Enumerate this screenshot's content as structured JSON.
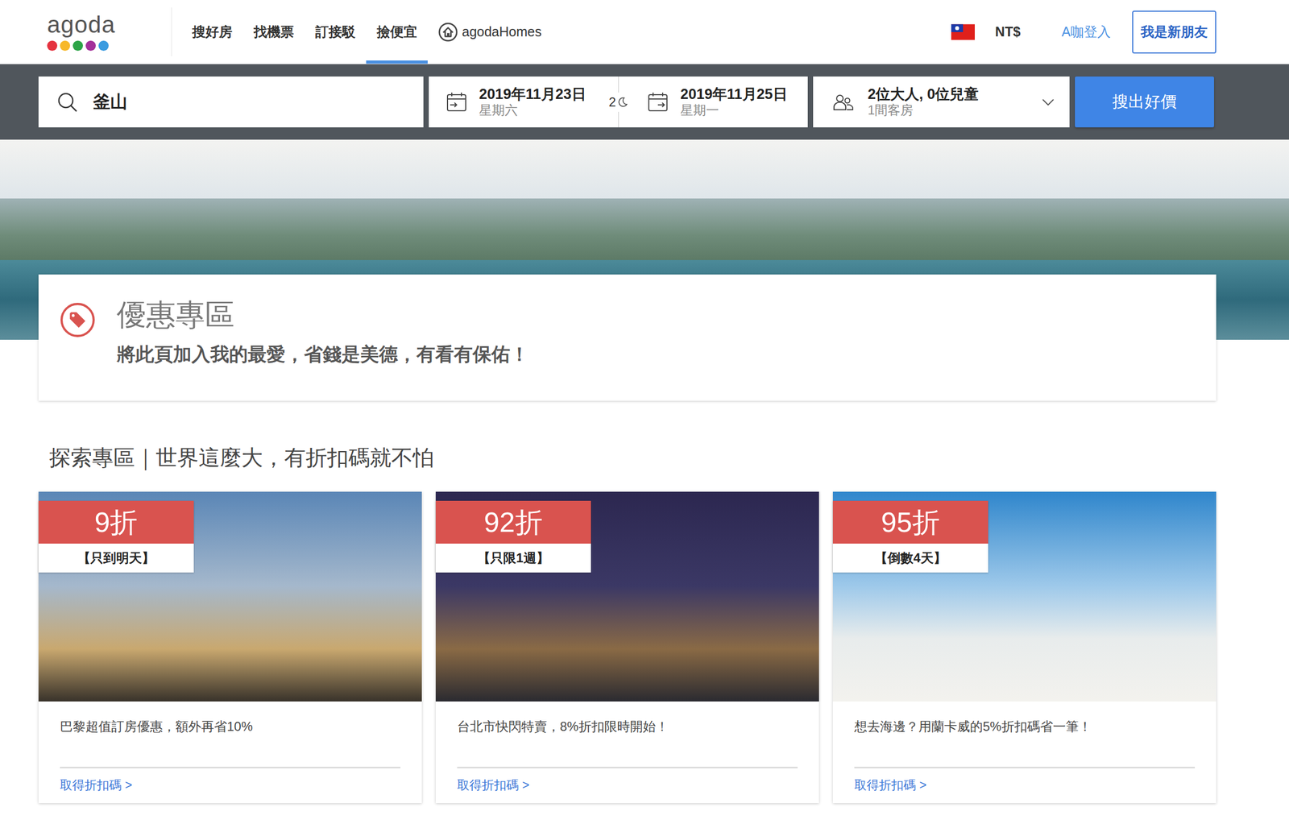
{
  "logo": {
    "text": "agoda"
  },
  "nav": [
    {
      "label": "搜好房",
      "selected": false
    },
    {
      "label": "找機票",
      "selected": false
    },
    {
      "label": "訂接駁",
      "selected": false
    },
    {
      "label": "撿便宜",
      "selected": true
    },
    {
      "label": "agodaHomes",
      "selected": false
    }
  ],
  "header": {
    "currency": "NT$",
    "login": "A咖登入",
    "signup": "我是新朋友"
  },
  "search": {
    "destination": "釜山",
    "checkin": {
      "date": "2019年11月23日",
      "weekday": "星期六"
    },
    "nights": "2",
    "checkout": {
      "date": "2019年11月25日",
      "weekday": "星期一"
    },
    "guests": "2位大人, 0位兒童",
    "rooms": "1間客房",
    "button": "搜出好價"
  },
  "promo": {
    "title": "優惠專區",
    "subtitle": "將此頁加入我的最愛，省錢是美德，有看有保佑！"
  },
  "section": {
    "title": "探索專區｜世界這麼大，有折扣碼就不怕"
  },
  "cards": [
    {
      "discount": "9折",
      "tag": "【只到明天】",
      "description": "巴黎超值訂房優惠，額外再省10%",
      "link": "取得折扣碼 >"
    },
    {
      "discount": "92折",
      "tag": "【只限1週】",
      "description": "台北市快閃特賣，8%折扣限時開始！",
      "link": "取得折扣碼 >"
    },
    {
      "discount": "95折",
      "tag": "【倒數4天】",
      "description": "想去海邊？用蘭卡威的5%折扣碼省一筆！",
      "link": "取得折扣碼 >"
    }
  ]
}
